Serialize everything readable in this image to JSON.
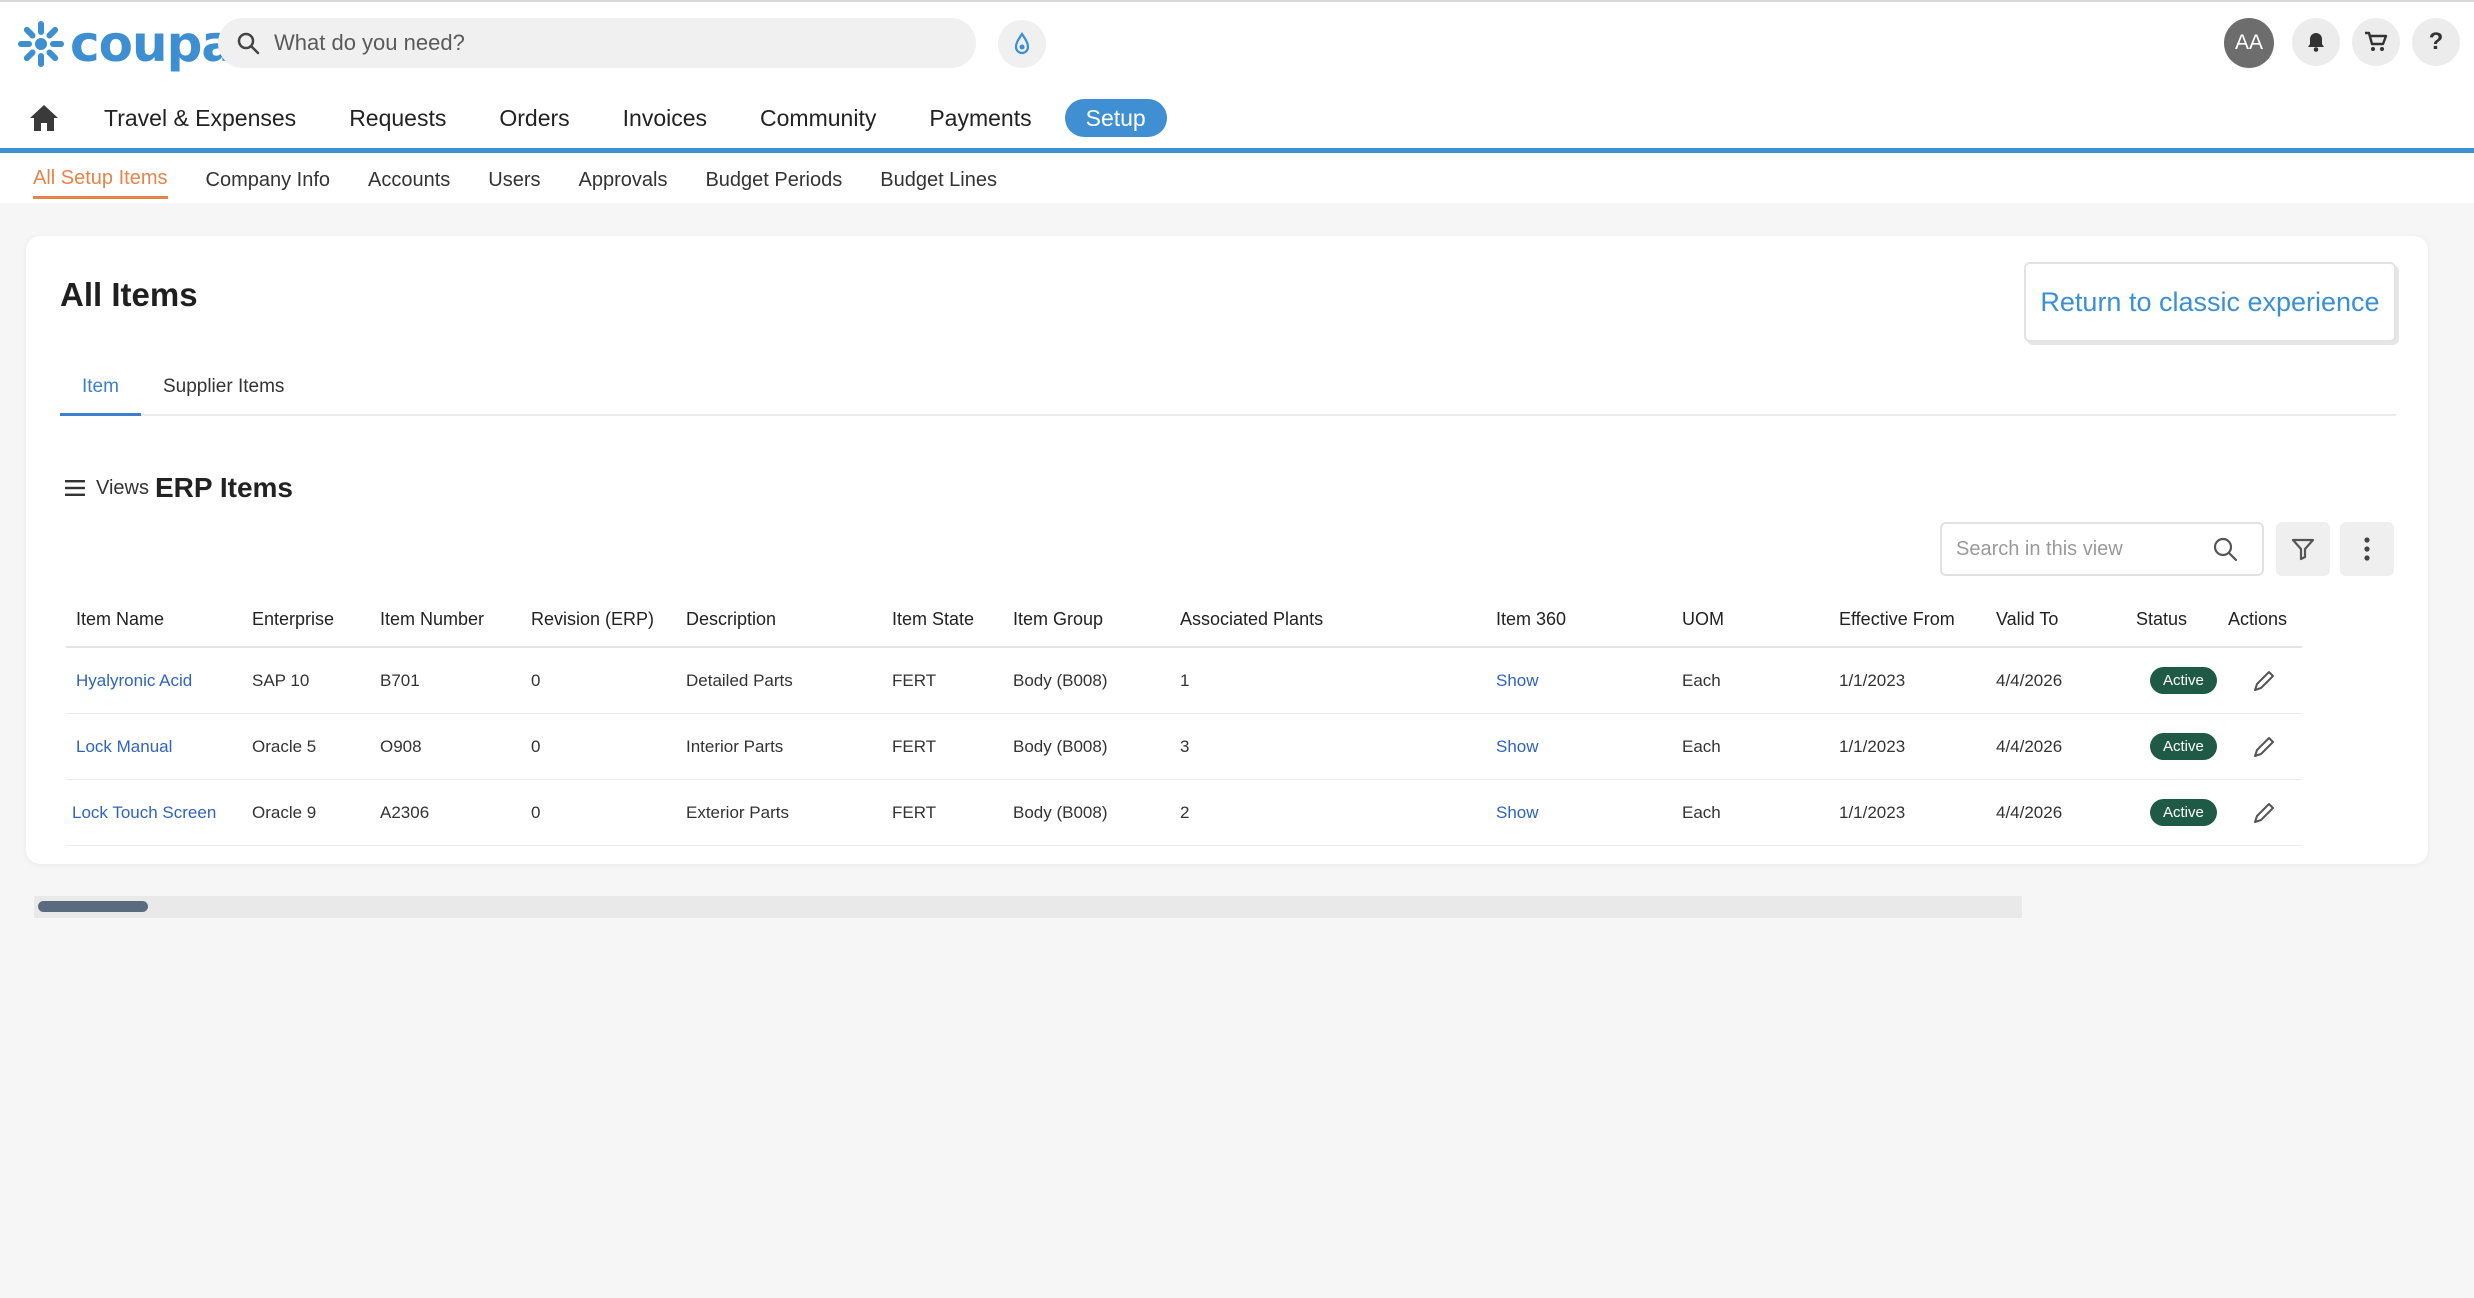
{
  "header": {
    "logo_text": "coupa",
    "search_placeholder": "What do you need?",
    "user_initials": "AA",
    "help_label": "?"
  },
  "nav": {
    "items": [
      "Travel & Expenses",
      "Requests",
      "Orders",
      "Invoices",
      "Community",
      "Payments"
    ],
    "active": "Setup"
  },
  "subnav": {
    "items": [
      "All Setup Items",
      "Company Info",
      "Accounts",
      "Users",
      "Approvals",
      "Budget Periods",
      "Budget Lines"
    ],
    "active_index": 0
  },
  "card": {
    "title": "All Items",
    "classic_button": "Return to classic experience",
    "tabs": [
      "Item",
      "Supplier Items"
    ],
    "active_tab": 0,
    "views_label": "Views",
    "view_name": "ERP Items",
    "view_search_placeholder": "Search in this view"
  },
  "table": {
    "columns": [
      "Item Name",
      "Enterprise",
      "Item Number",
      "Revision (ERP)",
      "Description",
      "Item State",
      "Item Group",
      "Associated Plants",
      "Item 360",
      "UOM",
      "Effective From",
      "Valid To",
      "Status",
      "Actions"
    ],
    "rows": [
      [
        "Hyalyronic Acid",
        "SAP 10",
        "B701",
        "0",
        "Detailed Parts",
        "FERT",
        "Body (B008)",
        "1",
        "Show",
        "Each",
        "1/1/2023",
        "4/4/2026",
        "Active"
      ],
      [
        "Lock Manual",
        "Oracle 5",
        "O908",
        "0",
        "Interior Parts",
        "FERT",
        "Body (B008)",
        "3",
        "Show",
        "Each",
        "1/1/2023",
        "4/4/2026",
        "Active"
      ],
      [
        "Lock Touch Screen",
        "Oracle 9",
        "A2306",
        "0",
        "Exterior Parts",
        "FERT",
        "Body (B008)",
        "2",
        "Show",
        "Each",
        "1/1/2023",
        "4/4/2026",
        "Active"
      ]
    ]
  },
  "colors": {
    "brand_blue": "#3f8fd2",
    "accent_orange": "#e8834a",
    "link_blue": "#2f63c2",
    "status_green": "#1f5a46"
  },
  "icons": [
    "search-icon",
    "bot-icon",
    "bell-icon",
    "cart-icon",
    "home-icon",
    "menu-icon",
    "filter-icon",
    "more-vertical-icon",
    "pencil-icon"
  ]
}
